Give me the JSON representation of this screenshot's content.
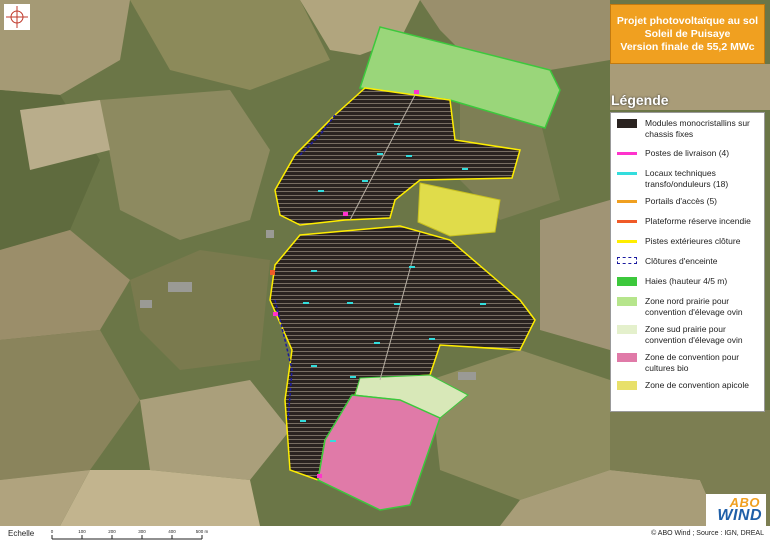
{
  "title": {
    "line1": "Projet photovoltaïque au sol",
    "line2": "Soleil de Puisaye",
    "line3": "Version finale de 55,2 MWc"
  },
  "legend": {
    "heading": "Légende",
    "items": [
      {
        "id": "modules",
        "label": "Modules monocristallins sur chassis fixes",
        "color": "#2a2320",
        "symbol": "fill"
      },
      {
        "id": "postes",
        "label": "Postes de livraison (4)",
        "color": "#ff33cc",
        "symbol": "bar"
      },
      {
        "id": "locaux",
        "label": "Locaux techniques transfo/onduleurs (18)",
        "color": "#33dddd",
        "symbol": "bar"
      },
      {
        "id": "portails",
        "label": "Portails d'accès (5)",
        "color": "#f0a020",
        "symbol": "bar"
      },
      {
        "id": "plateforme",
        "label": "Plateforme réserve incendie",
        "color": "#f05a28",
        "symbol": "bar"
      },
      {
        "id": "pistes",
        "label": "Pistes extérieures clôture",
        "color": "#ffee00",
        "symbol": "bar"
      },
      {
        "id": "clotures",
        "label": "Clôtures d'enceinte",
        "color": "#1a1aa0",
        "symbol": "dashed"
      },
      {
        "id": "haies",
        "label": "Haies (hauteur 4/5 m)",
        "color": "#3cc83c",
        "symbol": "fill"
      },
      {
        "id": "zone_nord",
        "label": "Zone nord prairie pour convention d'élevage ovin",
        "color": "#b6e58c",
        "symbol": "fill"
      },
      {
        "id": "zone_sud",
        "label": "Zone sud prairie pour convention d'élevage ovin",
        "color": "#e4f0cc",
        "symbol": "fill"
      },
      {
        "id": "zone_bio",
        "label": "Zone de convention pour cultures bio",
        "color": "#e07aa8",
        "symbol": "fill"
      },
      {
        "id": "zone_apicole",
        "label": "Zone de convention apicole",
        "color": "#e8e06a",
        "symbol": "fill"
      }
    ]
  },
  "scale": {
    "label": "Echelle",
    "ticks": [
      "0",
      "100",
      "200",
      "300",
      "400",
      "500 m"
    ]
  },
  "source": "© ABO Wind ; Source : IGN, DREAL",
  "logo": {
    "line1": "ABO",
    "line2": "WIND"
  }
}
